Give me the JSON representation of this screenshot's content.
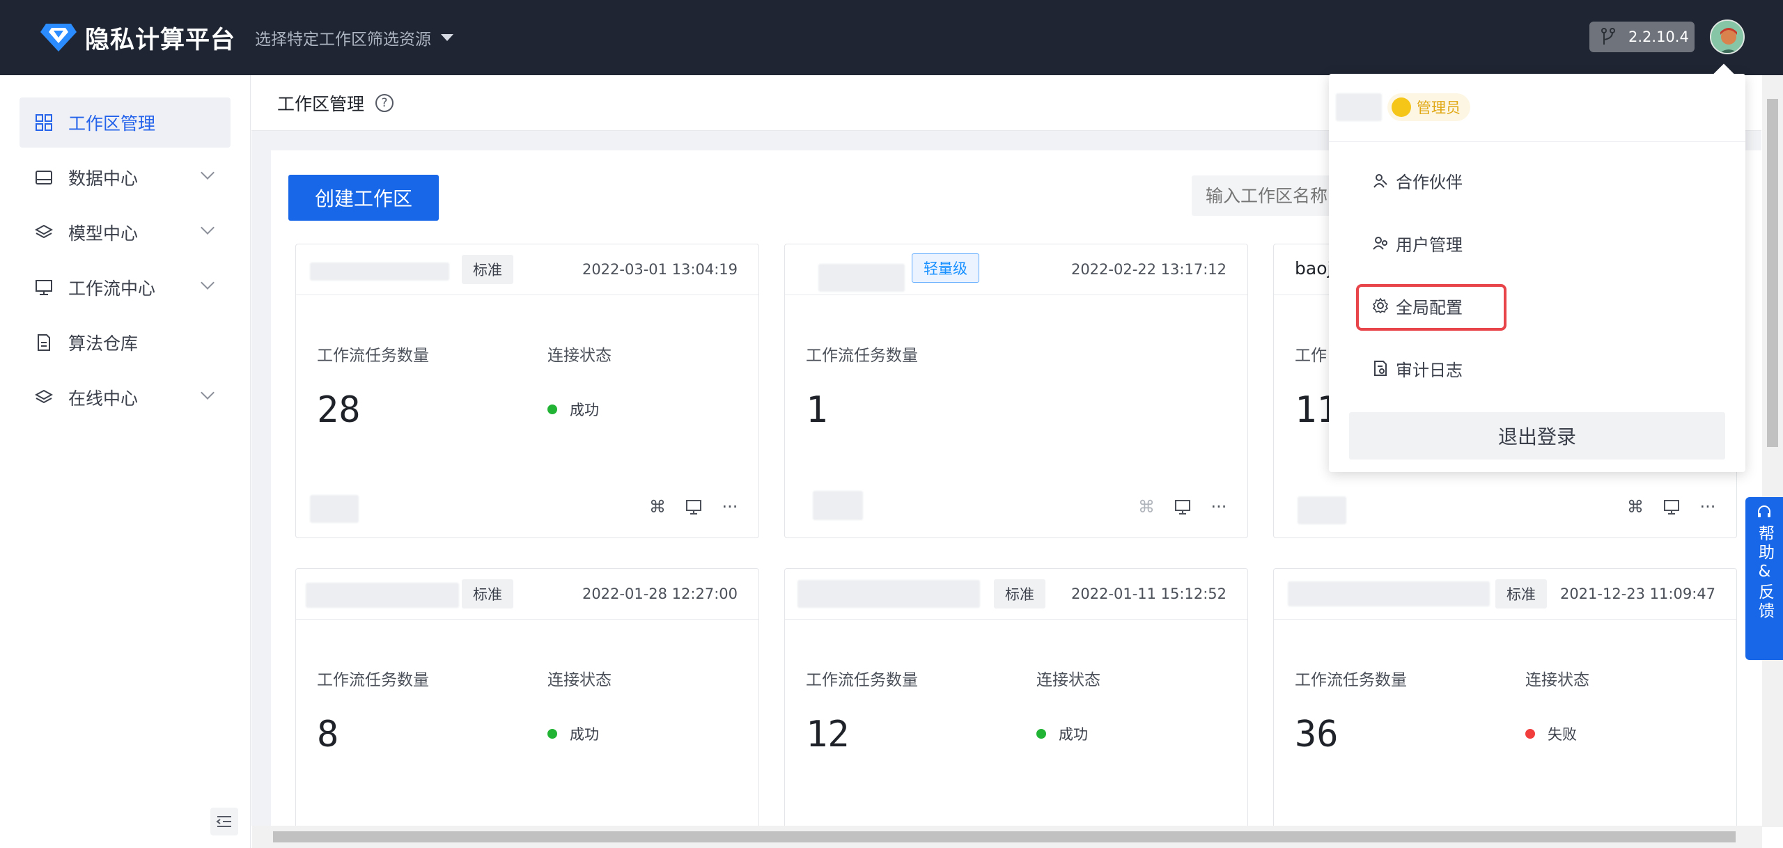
{
  "app": {
    "brand": "隐私计算平台",
    "workspace_selector": "选择特定工作区筛选资源",
    "version": "2.2.10.4",
    "accent_color": "#1867e8"
  },
  "sidebar": {
    "items": [
      {
        "label": "工作区管理",
        "icon": "grid-icon",
        "active": true
      },
      {
        "label": "数据中心",
        "icon": "database-icon",
        "expandable": true
      },
      {
        "label": "模型中心",
        "icon": "layers-icon",
        "expandable": true
      },
      {
        "label": "工作流中心",
        "icon": "monitor-icon",
        "expandable": true
      },
      {
        "label": "算法仓库",
        "icon": "file-icon"
      },
      {
        "label": "在线中心",
        "icon": "layers-icon",
        "expandable": true
      }
    ]
  },
  "page": {
    "title": "工作区管理",
    "create_button": "创建工作区",
    "search_placeholder": "输入工作区名称"
  },
  "cards": [
    {
      "name": "",
      "tag": "标准",
      "time": "2022-03-01 13:04:19",
      "task_label": "工作流任务数量",
      "task_count": "28",
      "conn_label": "连接状态",
      "status": "成功",
      "status_color": "#20b334"
    },
    {
      "name": "",
      "tag": "轻量级",
      "time": "2022-02-22 13:17:12",
      "task_label": "工作流任务数量",
      "task_count": "1"
    },
    {
      "name": "baoj",
      "task_label": "工作",
      "task_count": "11"
    },
    {
      "name": "",
      "tag": "标准",
      "time": "2022-01-28 12:27:00",
      "task_label": "工作流任务数量",
      "task_count": "8",
      "conn_label": "连接状态",
      "status": "成功",
      "status_color": "#20b334"
    },
    {
      "name": "",
      "tag": "标准",
      "time": "2022-01-11 15:12:52",
      "task_label": "工作流任务数量",
      "task_count": "12",
      "conn_label": "连接状态",
      "status": "成功",
      "status_color": "#20b334"
    },
    {
      "name": "",
      "tag": "标准",
      "time": "2021-12-23 11:09:47",
      "task_label": "工作流任务数量",
      "task_count": "36",
      "conn_label": "连接状态",
      "status": "失败",
      "status_color": "#f23d3d"
    }
  ],
  "user_menu": {
    "role_badge": "管理员",
    "items": [
      {
        "label": "合作伙伴",
        "icon": "partner-icon"
      },
      {
        "label": "用户管理",
        "icon": "users-icon"
      },
      {
        "label": "全局配置",
        "icon": "gear-icon",
        "highlighted": true
      },
      {
        "label": "审计日志",
        "icon": "audit-log-icon"
      }
    ],
    "logout": "退出登录"
  },
  "help_float": "帮助&反馈"
}
